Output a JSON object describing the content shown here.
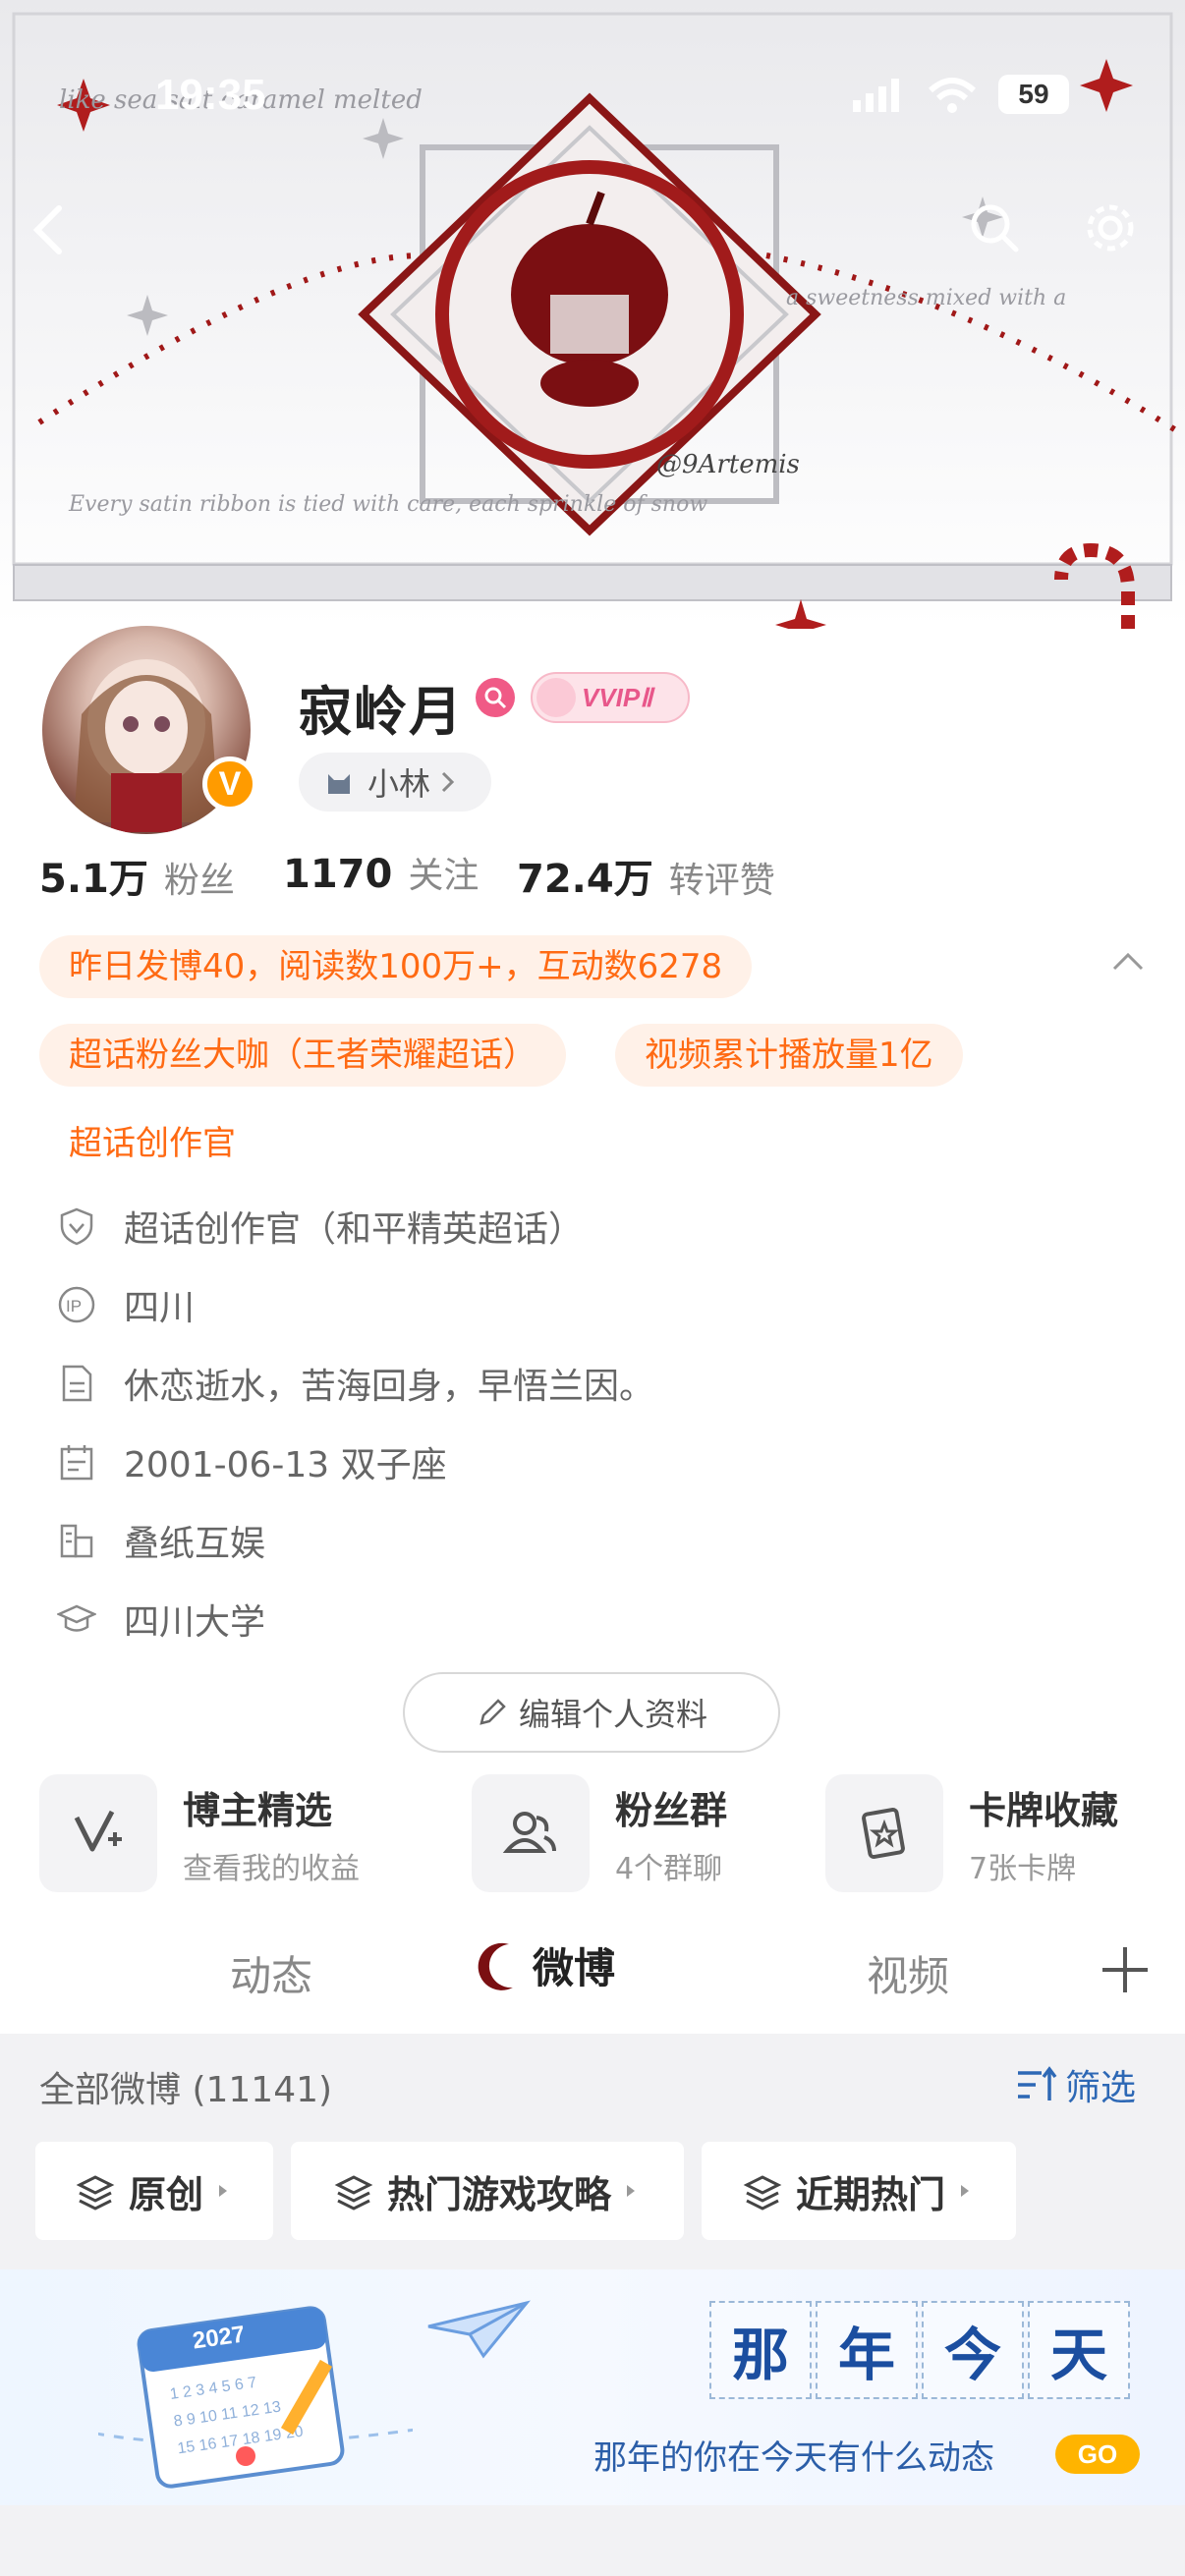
{
  "status_bar": {
    "time": "19:35",
    "battery": "59"
  },
  "banner": {
    "watermark": "@9Artemis"
  },
  "profile": {
    "name": "寂岭月",
    "vip_label": "VVIPⅡ",
    "verified_mark": "V",
    "sub_link": "小林",
    "stats": [
      {
        "value": "5.1万",
        "label": "粉丝"
      },
      {
        "value": "1170",
        "label": "关注"
      },
      {
        "value": "72.4万",
        "label": "转评赞"
      }
    ],
    "tags": [
      "昨日发博40，阅读数100万+，互动数6278",
      "超话粉丝大咖（王者荣耀超话）",
      "视频累计播放量1亿",
      "超话创作官"
    ],
    "info": [
      {
        "icon": "shield-icon",
        "text": "超话创作官（和平精英超话）"
      },
      {
        "icon": "ip-icon",
        "text": "四川"
      },
      {
        "icon": "document-icon",
        "text": "休恋逝水，苦海回身，早悟兰因。"
      },
      {
        "icon": "calendar-icon",
        "text": "2001-06-13 双子座"
      },
      {
        "icon": "company-icon",
        "text": "叠纸互娱"
      },
      {
        "icon": "graduation-cap-icon",
        "text": "四川大学"
      }
    ],
    "edit_button": "编辑个人资料"
  },
  "cards": [
    {
      "icon": "v-plus-icon",
      "title": "博主精选",
      "sub": "查看我的收益"
    },
    {
      "icon": "fans-group-icon",
      "title": "粉丝群",
      "sub": "4个群聊"
    },
    {
      "icon": "card-collection-icon",
      "title": "卡牌收藏",
      "sub": "7张卡牌"
    }
  ],
  "tabs": [
    "动态",
    "微博",
    "视频"
  ],
  "feed": {
    "header": "全部微博 (11141)",
    "filter_label": "筛选",
    "filters": [
      "原创",
      "热门游戏攻略",
      "近期热门"
    ]
  },
  "promo": {
    "chars": [
      "那",
      "年",
      "今",
      "天"
    ],
    "subtitle": "那年的你在今天有什么动态",
    "go": "GO",
    "calendar_year": "2027"
  },
  "colors": {
    "accent": "#ff6a13",
    "verified": "#ff9b00",
    "banner_red": "#9e1b1b"
  }
}
